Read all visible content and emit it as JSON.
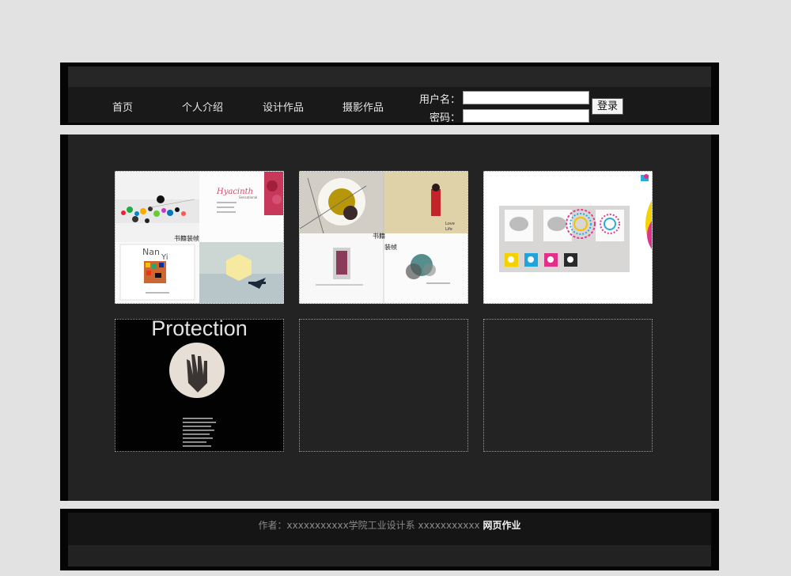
{
  "nav": {
    "items": [
      "首页",
      "个人介绍",
      "设计作品",
      "摄影作品"
    ]
  },
  "login": {
    "username_label": "用户名：",
    "password_label": "密码：",
    "username_value": "",
    "password_value": "",
    "button_label": "登录"
  },
  "gallery": {
    "tile1": {
      "heading": "Hyacinth",
      "subheading": "Sensational",
      "caption": "书籍装帧",
      "name_line1": "Nan",
      "name_line2": "Yi"
    },
    "tile2": {
      "caption1": "书籍",
      "caption2": "装帧",
      "side_text1": "Love",
      "side_text2": "Life"
    },
    "tile4": {
      "title": "Protection"
    }
  },
  "footer": {
    "author_text": "作者：xxxxxxxxxxx学院工业设计系 xxxxxxxxxxx",
    "highlight_text": "网页作业"
  },
  "colors": {
    "background": "#e2e2e2",
    "frame": "#050505",
    "panel": "#232323",
    "accent_gold": "#b8960a",
    "accent_red": "#c0203a"
  }
}
